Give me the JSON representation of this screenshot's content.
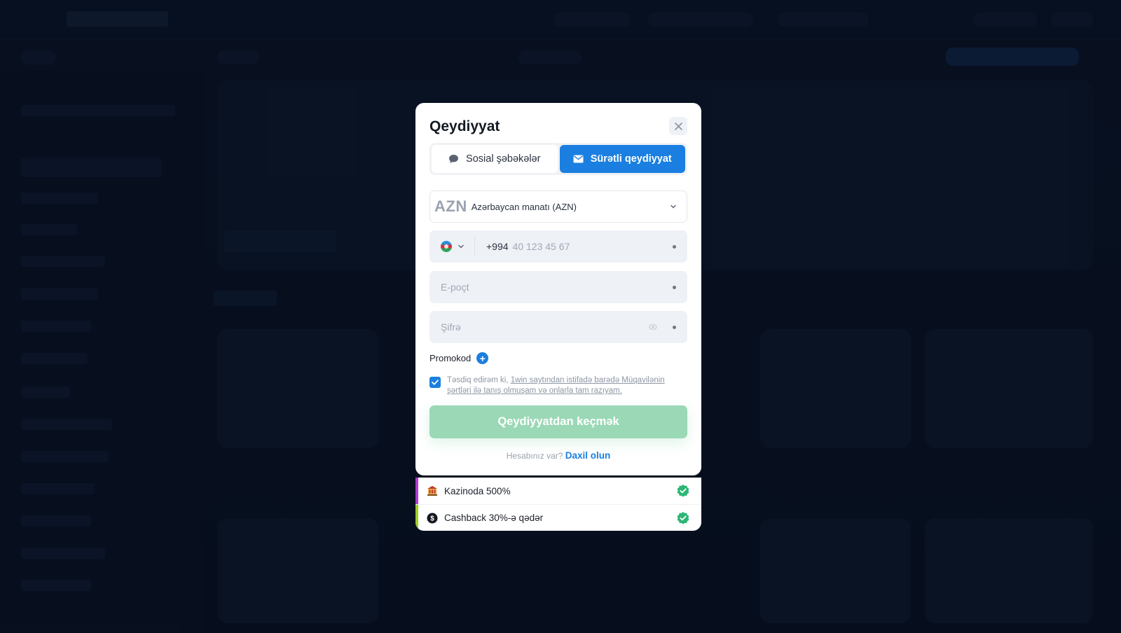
{
  "modal": {
    "title": "Qeydiyyat",
    "tabs": [
      {
        "label": "Sosial şəbəkələr",
        "icon": "chat-bubble-icon",
        "active": false
      },
      {
        "label": "Sürətli qeydiyyat",
        "icon": "envelope-icon",
        "active": true
      }
    ],
    "currency": {
      "code": "AZN",
      "name": "Azərbaycan manatı (AZN)"
    },
    "phone": {
      "country": "Azerbaijan",
      "prefix": "+994",
      "placeholder": "40 123 45 67"
    },
    "email": {
      "placeholder": "E-poçt"
    },
    "password": {
      "placeholder": "Şifrə"
    },
    "promo": {
      "label": "Promokod",
      "add_symbol": "+"
    },
    "terms": {
      "checked": true,
      "prefix": "Təsdiq edirəm ki, ",
      "link": "1win saytından istifadə barədə Müqavilənin şərtləri ilə tanış olmuşam və onlarla tam razıyam."
    },
    "submit_label": "Qeydiyyatdan keçmək",
    "login_prompt": "Hesabınız var?",
    "login_link": "Daxil olun"
  },
  "bonuses": [
    {
      "label": "Kazinoda 500%",
      "icon": "casino-icon",
      "accent": "#b03ccf"
    },
    {
      "label": "Cashback 30%-ə qədər",
      "icon": "cashback-icon",
      "accent": "#9ccf1f"
    }
  ],
  "colors": {
    "primary": "#1a7fe0",
    "submit_disabled": "#9ad8b6",
    "check_badge": "#2bb673"
  }
}
